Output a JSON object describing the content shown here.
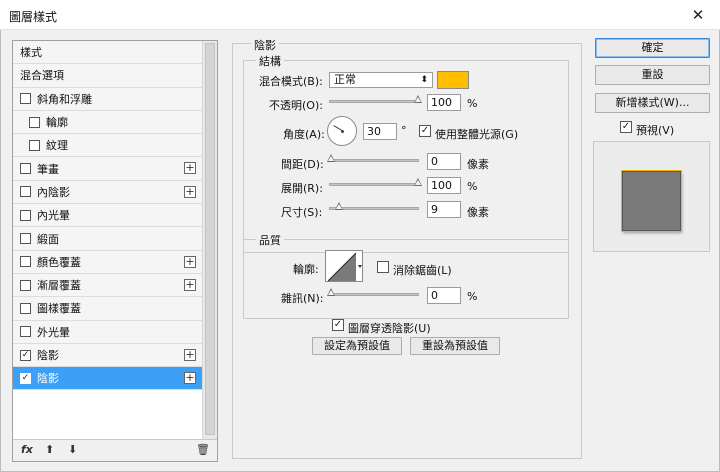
{
  "window": {
    "title": "圖層樣式",
    "close_glyph": "✕"
  },
  "style_list": {
    "items": [
      {
        "label": "樣式",
        "checkbox": false,
        "checked": false,
        "plus": false,
        "selected": false,
        "indent": false
      },
      {
        "label": "混合選項",
        "checkbox": false,
        "checked": false,
        "plus": false,
        "selected": false,
        "indent": false
      },
      {
        "label": "斜角和浮雕",
        "checkbox": true,
        "checked": false,
        "plus": false,
        "selected": false,
        "indent": false
      },
      {
        "label": "輪廓",
        "checkbox": true,
        "checked": false,
        "plus": false,
        "selected": false,
        "indent": true
      },
      {
        "label": "紋理",
        "checkbox": true,
        "checked": false,
        "plus": false,
        "selected": false,
        "indent": true
      },
      {
        "label": "筆畫",
        "checkbox": true,
        "checked": false,
        "plus": true,
        "selected": false,
        "indent": false
      },
      {
        "label": "內陰影",
        "checkbox": true,
        "checked": false,
        "plus": true,
        "selected": false,
        "indent": false
      },
      {
        "label": "內光暈",
        "checkbox": true,
        "checked": false,
        "plus": false,
        "selected": false,
        "indent": false
      },
      {
        "label": "緞面",
        "checkbox": true,
        "checked": false,
        "plus": false,
        "selected": false,
        "indent": false
      },
      {
        "label": "顏色覆蓋",
        "checkbox": true,
        "checked": false,
        "plus": true,
        "selected": false,
        "indent": false
      },
      {
        "label": "漸層覆蓋",
        "checkbox": true,
        "checked": false,
        "plus": true,
        "selected": false,
        "indent": false
      },
      {
        "label": "圖樣覆蓋",
        "checkbox": true,
        "checked": false,
        "plus": false,
        "selected": false,
        "indent": false
      },
      {
        "label": "外光暈",
        "checkbox": true,
        "checked": false,
        "plus": false,
        "selected": false,
        "indent": false
      },
      {
        "label": "陰影",
        "checkbox": true,
        "checked": true,
        "plus": true,
        "selected": false,
        "indent": false
      },
      {
        "label": "陰影",
        "checkbox": true,
        "checked": true,
        "plus": true,
        "selected": true,
        "indent": false
      }
    ],
    "bottom": {
      "fx": "fx",
      "up": "⬆",
      "down": "⬇",
      "trash": "🗑"
    }
  },
  "drop_shadow": {
    "section_title": "陰影",
    "structure": {
      "title": "結構",
      "blend_mode_label": "混合模式(B):",
      "blend_mode_value": "正常",
      "shadow_color": "#ffbf00",
      "opacity_label": "不透明(O):",
      "opacity_value": "100",
      "opacity_unit": "%",
      "angle_label": "角度(A):",
      "angle_value": "30",
      "angle_unit": "°",
      "global_light_label": "使用整體光源(G)",
      "global_light_checked": true,
      "distance_label": "間距(D):",
      "distance_value": "0",
      "distance_unit": "像素",
      "spread_label": "展開(R):",
      "spread_value": "100",
      "spread_unit": "%",
      "size_label": "尺寸(S):",
      "size_value": "9",
      "size_unit": "像素"
    },
    "quality": {
      "title": "品質",
      "contour_label": "輪廓:",
      "antialias_label": "消除鋸齒(L)",
      "antialias_checked": false,
      "noise_label": "雜訊(N):",
      "noise_value": "0",
      "noise_unit": "%"
    },
    "knockout_label": "圖層穿透陰影(U)",
    "knockout_checked": true,
    "make_default_label": "設定為預設值",
    "reset_default_label": "重設為預設值"
  },
  "side_buttons": {
    "ok": "確定",
    "reset": "重設",
    "new_style": "新增樣式(W)...",
    "preview_label": "預視(V)",
    "preview_checked": true
  }
}
